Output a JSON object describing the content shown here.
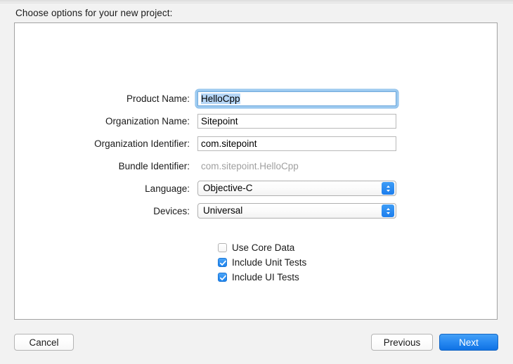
{
  "dialog": {
    "prompt": "Choose options for your new project:"
  },
  "form": {
    "fields": [
      {
        "label": "Product Name:",
        "value": "HelloCpp",
        "type": "text",
        "focused": true,
        "selected": true
      },
      {
        "label": "Organization Name:",
        "value": "Sitepoint",
        "type": "text",
        "focused": false,
        "selected": false
      },
      {
        "label": "Organization Identifier:",
        "value": "com.sitepoint",
        "type": "text",
        "focused": false,
        "selected": false
      },
      {
        "label": "Bundle Identifier:",
        "value": "com.sitepoint.HelloCpp",
        "type": "static",
        "focused": false,
        "selected": false
      },
      {
        "label": "Language:",
        "value": "Objective-C",
        "type": "popup",
        "focused": false,
        "selected": false
      },
      {
        "label": "Devices:",
        "value": "Universal",
        "type": "popup",
        "focused": false,
        "selected": false
      }
    ]
  },
  "checkboxes": [
    {
      "label": "Use Core Data",
      "checked": false
    },
    {
      "label": "Include Unit Tests",
      "checked": true
    },
    {
      "label": "Include UI Tests",
      "checked": true
    }
  ],
  "buttons": {
    "cancel": "Cancel",
    "previous": "Previous",
    "next": "Next"
  },
  "icons": {
    "popup_chevron": "chevron-up-down-icon",
    "checkmark": "checkmark-icon"
  },
  "colors": {
    "accent": "#1d84ee",
    "default_button": "#2a8bf2",
    "focus_ring": "#9ccaf0",
    "selection": "#b6d6f6",
    "static_text": "#a0a0a0",
    "window_background": "#f2f2f2",
    "panel_background": "#ffffff",
    "panel_border": "#a2a2a2"
  }
}
